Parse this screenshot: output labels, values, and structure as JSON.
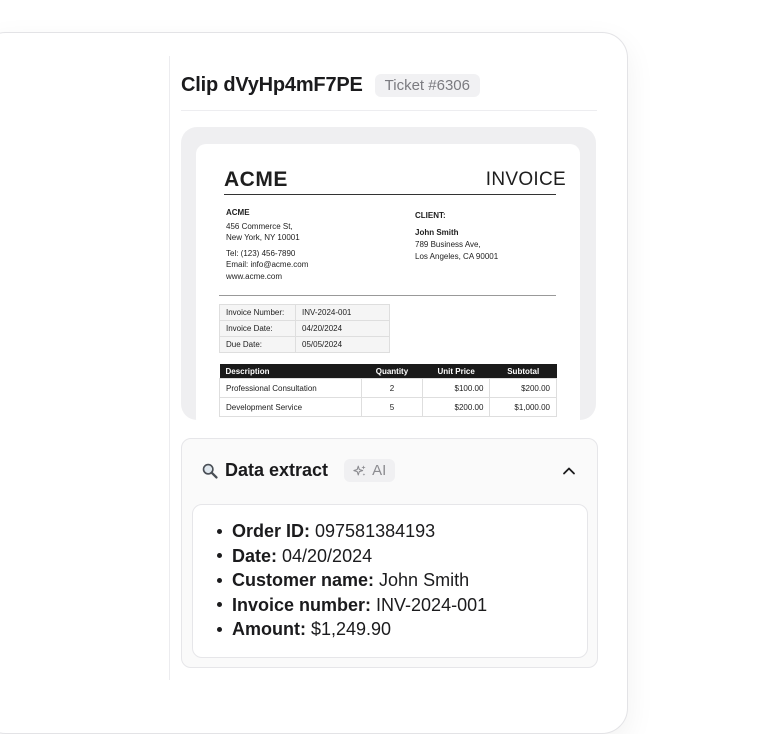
{
  "clip": {
    "title": "Clip dVyHp4mF7PE",
    "ticket": "Ticket #6306"
  },
  "invoice": {
    "logo": "ACME",
    "heading": "INVOICE",
    "from": {
      "name": "ACME",
      "address1": "456 Commerce St,",
      "address2": "New York, NY 10001",
      "tel": "Tel: (123) 456-7890",
      "email": "Email: info@acme.com",
      "web": "www.acme.com"
    },
    "client": {
      "label": "CLIENT:",
      "name": "John Smith",
      "address1": "789 Business Ave,",
      "address2": "Los Angeles, CA 90001"
    },
    "meta": [
      {
        "key": "Invoice Number:",
        "value": "INV-2024-001"
      },
      {
        "key": "Invoice Date:",
        "value": "04/20/2024"
      },
      {
        "key": "Due Date:",
        "value": "05/05/2024"
      }
    ],
    "columns": [
      "Description",
      "Quantity",
      "Unit Price",
      "Subtotal"
    ],
    "rows": [
      [
        "Professional Consultation",
        "2",
        "$100.00",
        "$200.00"
      ],
      [
        "Development Service",
        "5",
        "$200.00",
        "$1,000.00"
      ]
    ]
  },
  "extract": {
    "title": "Data extract",
    "ai_label": "AI",
    "icons": {
      "search": "search-icon",
      "ai": "sparkle-icon",
      "toggle": "chevron-up-icon"
    },
    "items": [
      {
        "label": "Order ID:",
        "value": "097581384193"
      },
      {
        "label": "Date:",
        "value": "04/20/2024"
      },
      {
        "label": "Customer name:",
        "value": "John Smith"
      },
      {
        "label": "Invoice number:",
        "value": "INV-2024-001"
      },
      {
        "label": "Amount:",
        "value": "$1,249.90"
      }
    ]
  }
}
